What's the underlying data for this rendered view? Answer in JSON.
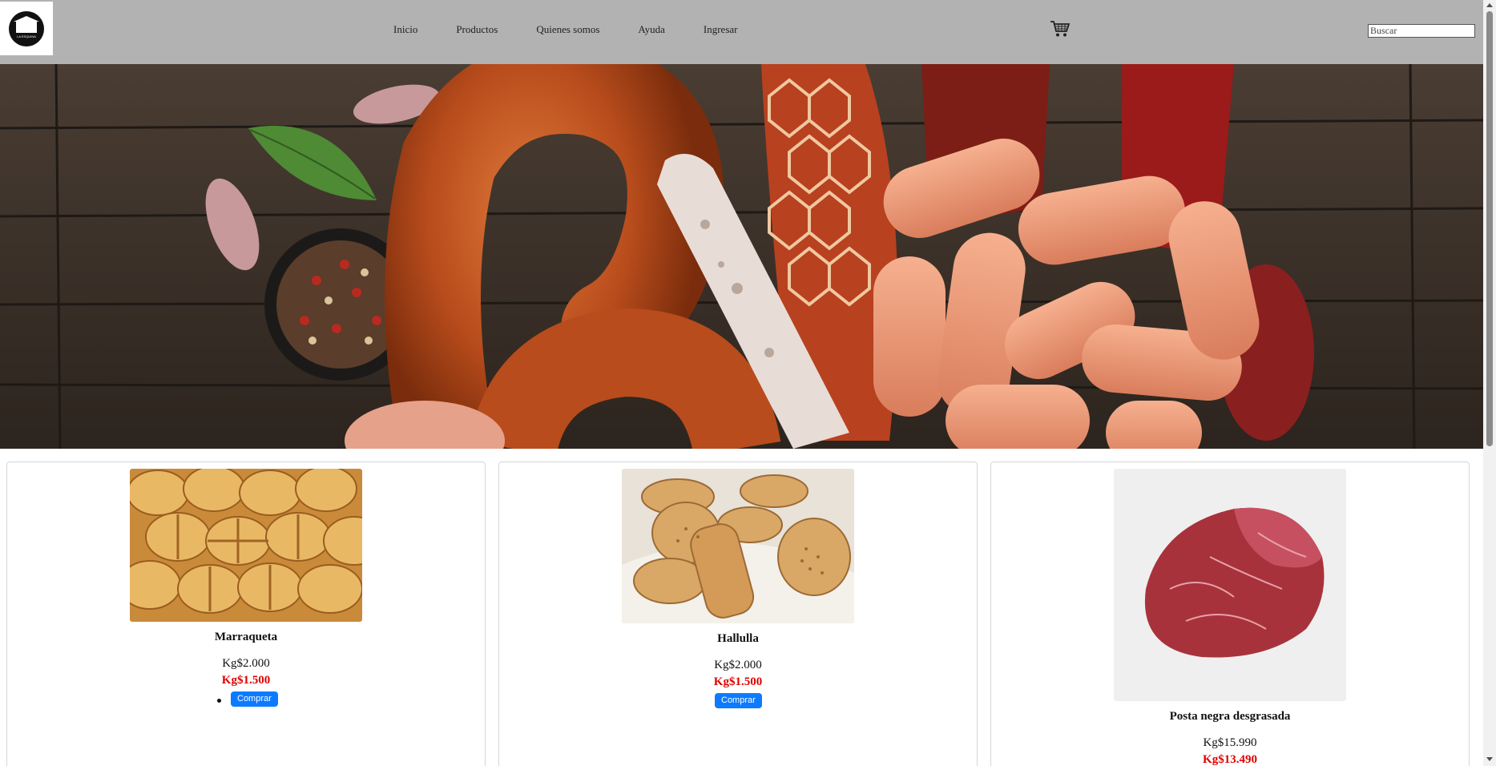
{
  "header": {
    "logo_text": "LA ESQUINA",
    "nav": [
      "Inicio",
      "Productos",
      "Quienes somos",
      "Ayuda",
      "Ingresar"
    ],
    "search_placeholder": "Buscar"
  },
  "products": [
    {
      "name": "Marraqueta",
      "price": "Kg$2.000",
      "sale_price": "Kg$1.500",
      "button": "Comprar"
    },
    {
      "name": "Hallulla",
      "price": "Kg$2.000",
      "sale_price": "Kg$1.500",
      "button": "Comprar"
    },
    {
      "name": "Posta negra desgrasada",
      "price": "Kg$15.990",
      "sale_price": "Kg$13.490"
    }
  ],
  "colors": {
    "header_bg": "#b2b2b2",
    "button": "#0d7bff",
    "sale": "#e00000"
  }
}
